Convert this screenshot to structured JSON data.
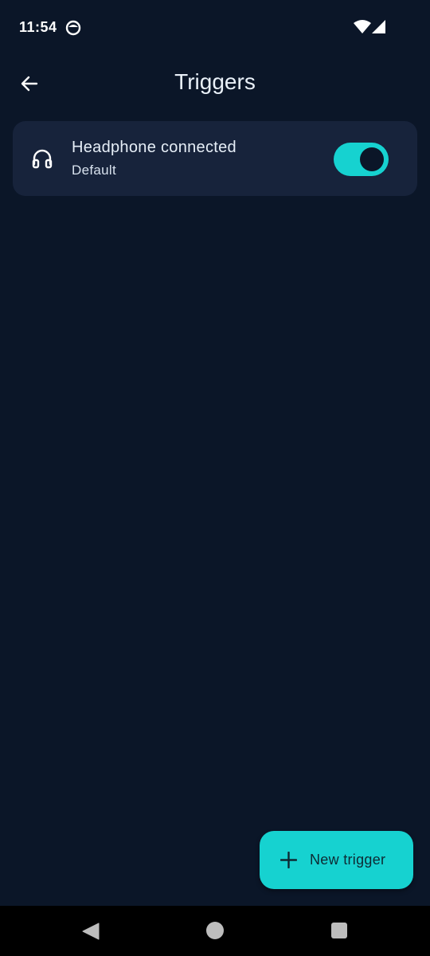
{
  "status_bar": {
    "time": "11:54",
    "icons": [
      "app-notification-icon",
      "wifi-icon",
      "cellular-signal-icon"
    ]
  },
  "app_bar": {
    "title": "Triggers",
    "back_icon": "arrow-left-icon"
  },
  "triggers": [
    {
      "icon": "headphones-icon",
      "title": "Headphone connected",
      "subtitle": "Default",
      "enabled": true
    }
  ],
  "fab": {
    "icon": "plus-icon",
    "label": "New trigger"
  },
  "nav_bar": {
    "icons": [
      "nav-back-icon",
      "nav-home-icon",
      "nav-recents-icon"
    ]
  },
  "colors": {
    "background": "#0b1628",
    "card": "#17233b",
    "accent": "#16d2d0",
    "text": "#e6eef7",
    "nav_bar": "#000000"
  }
}
